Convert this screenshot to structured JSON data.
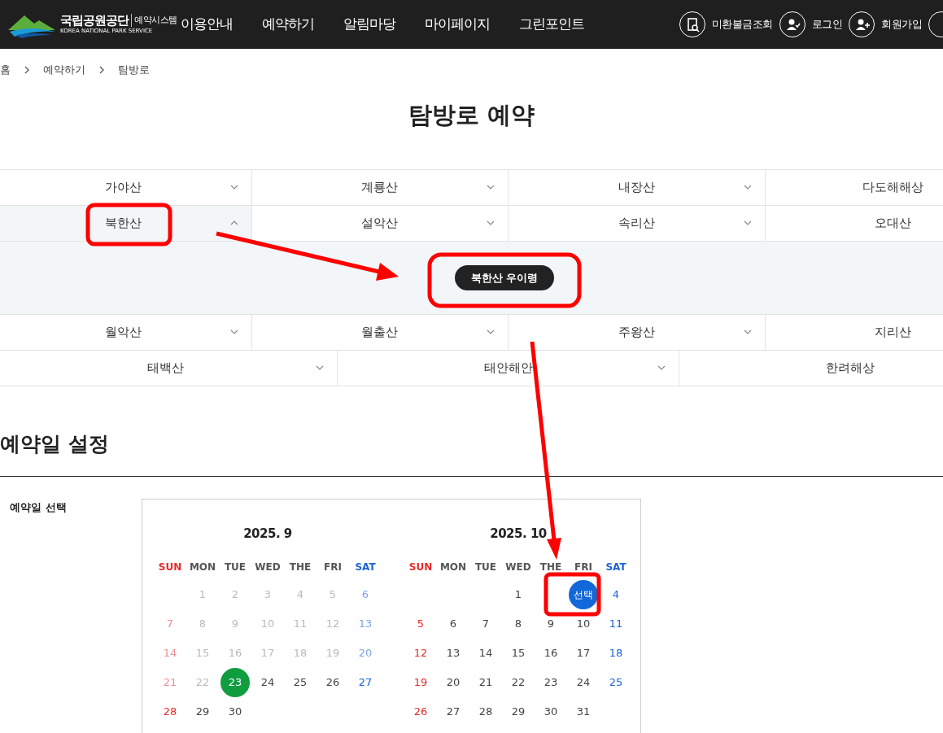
{
  "header": {
    "logo_title": "국립공원공단",
    "logo_sub": "예약시스템",
    "logo_caption": "KOREA NATIONAL PARK SERVICE",
    "menu": [
      {
        "label": "이용안내"
      },
      {
        "label": "예약하기"
      },
      {
        "label": "알림마당"
      },
      {
        "label": "마이페이지"
      },
      {
        "label": "그린포인트"
      }
    ],
    "utilities": [
      {
        "label": "미환불금조회",
        "kind": "refund"
      },
      {
        "label": "로그인",
        "kind": "login"
      },
      {
        "label": "회원가입",
        "kind": "join"
      }
    ]
  },
  "breadcrumb": [
    "홈",
    "예약하기",
    "탐방로"
  ],
  "page_title": "탐방로 예약",
  "mountain_rows": [
    [
      {
        "name": "가야산",
        "expanded": false
      },
      {
        "name": "계룡산",
        "expanded": false
      },
      {
        "name": "내장산",
        "expanded": false
      },
      {
        "name": "다도해해상",
        "expanded": false
      }
    ],
    [
      {
        "name": "북한산",
        "expanded": true,
        "courses": [
          {
            "label": "북한산 우이령"
          }
        ]
      },
      {
        "name": "설악산",
        "expanded": false
      },
      {
        "name": "속리산",
        "expanded": false
      },
      {
        "name": "오대산",
        "expanded": false
      }
    ],
    [
      {
        "name": "월악산",
        "expanded": false
      },
      {
        "name": "월출산",
        "expanded": false
      },
      {
        "name": "주왕산",
        "expanded": false
      },
      {
        "name": "지리산",
        "expanded": false
      }
    ],
    [
      {
        "name": "태백산",
        "expanded": false
      },
      {
        "name": "태안해안",
        "expanded": false
      },
      {
        "name": "한려해상",
        "expanded": false
      }
    ]
  ],
  "date_section": {
    "heading": "예약일 설정",
    "label": "예약일 선택",
    "months": [
      {
        "title": "2025. 9",
        "weekdays": [
          "SUN",
          "MON",
          "TUE",
          "WED",
          "THE",
          "FRI",
          "SAT"
        ],
        "weeks": [
          [
            {
              "kind": "empty"
            },
            {
              "day": "1",
              "kind": "past"
            },
            {
              "day": "2",
              "kind": "past"
            },
            {
              "day": "3",
              "kind": "past"
            },
            {
              "day": "4",
              "kind": "past"
            },
            {
              "day": "5",
              "kind": "past"
            },
            {
              "day": "6",
              "kind": "past"
            }
          ],
          [
            {
              "day": "7",
              "kind": "past"
            },
            {
              "day": "8",
              "kind": "past"
            },
            {
              "day": "9",
              "kind": "past"
            },
            {
              "day": "10",
              "kind": "past"
            },
            {
              "day": "11",
              "kind": "past"
            },
            {
              "day": "12",
              "kind": "past"
            },
            {
              "day": "13",
              "kind": "past"
            }
          ],
          [
            {
              "day": "14",
              "kind": "past"
            },
            {
              "day": "15",
              "kind": "past"
            },
            {
              "day": "16",
              "kind": "past"
            },
            {
              "day": "17",
              "kind": "past"
            },
            {
              "day": "18",
              "kind": "past"
            },
            {
              "day": "19",
              "kind": "past"
            },
            {
              "day": "20",
              "kind": "past"
            }
          ],
          [
            {
              "day": "21",
              "kind": "past"
            },
            {
              "day": "22",
              "kind": "past"
            },
            {
              "day": "23",
              "kind": "today"
            },
            {
              "day": "24",
              "kind": "open"
            },
            {
              "day": "25",
              "kind": "open"
            },
            {
              "day": "26",
              "kind": "open"
            },
            {
              "day": "27",
              "kind": "open"
            }
          ],
          [
            {
              "day": "28",
              "kind": "open"
            },
            {
              "day": "29",
              "kind": "open"
            },
            {
              "day": "30",
              "kind": "open"
            }
          ]
        ]
      },
      {
        "title": "2025. 10",
        "weekdays": [
          "SUN",
          "MON",
          "TUE",
          "WED",
          "THE",
          "FRI",
          "SAT"
        ],
        "weeks": [
          [
            {
              "kind": "empty"
            },
            {
              "kind": "empty"
            },
            {
              "kind": "empty"
            },
            {
              "day": "1",
              "kind": "open"
            },
            {
              "kind": "empty"
            },
            {
              "day": "선택",
              "kind": "picked"
            },
            {
              "day": "4",
              "kind": "open"
            }
          ],
          [
            {
              "day": "5",
              "kind": "open"
            },
            {
              "day": "6",
              "kind": "open"
            },
            {
              "day": "7",
              "kind": "open"
            },
            {
              "day": "8",
              "kind": "open"
            },
            {
              "day": "9",
              "kind": "open"
            },
            {
              "day": "10",
              "kind": "open"
            },
            {
              "day": "11",
              "kind": "open"
            }
          ],
          [
            {
              "day": "12",
              "kind": "open"
            },
            {
              "day": "13",
              "kind": "open"
            },
            {
              "day": "14",
              "kind": "open"
            },
            {
              "day": "15",
              "kind": "open"
            },
            {
              "day": "16",
              "kind": "open"
            },
            {
              "day": "17",
              "kind": "open"
            },
            {
              "day": "18",
              "kind": "open"
            }
          ],
          [
            {
              "day": "19",
              "kind": "open"
            },
            {
              "day": "20",
              "kind": "open"
            },
            {
              "day": "21",
              "kind": "open"
            },
            {
              "day": "22",
              "kind": "open"
            },
            {
              "day": "23",
              "kind": "open"
            },
            {
              "day": "24",
              "kind": "open"
            },
            {
              "day": "25",
              "kind": "open"
            }
          ],
          [
            {
              "day": "26",
              "kind": "open"
            },
            {
              "day": "27",
              "kind": "open"
            },
            {
              "day": "28",
              "kind": "open"
            },
            {
              "day": "29",
              "kind": "open"
            },
            {
              "day": "30",
              "kind": "open"
            },
            {
              "day": "31",
              "kind": "open"
            }
          ]
        ]
      }
    ]
  }
}
